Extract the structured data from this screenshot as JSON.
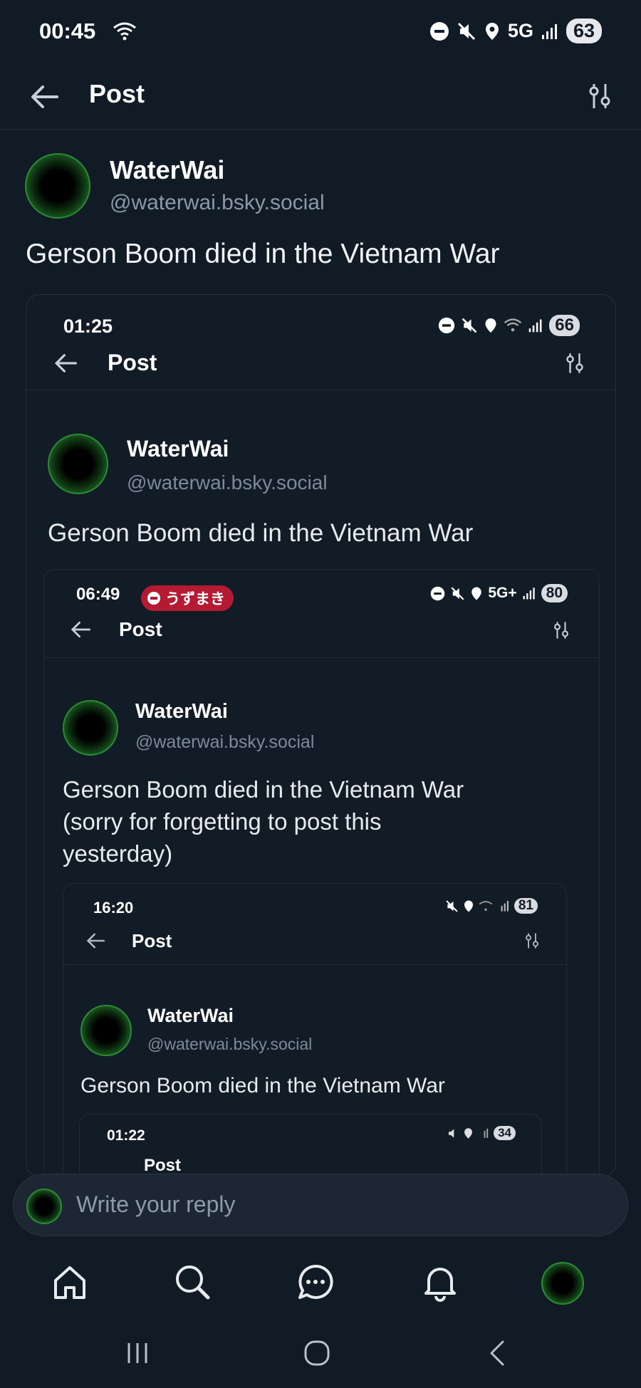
{
  "status_bar": {
    "time": "00:45",
    "network": "5G",
    "battery": "63"
  },
  "header": {
    "title": "Post"
  },
  "post": {
    "author_name": "WaterWai",
    "author_handle": "@waterwai.bsky.social",
    "text": "Gerson Boom died in the Vietnam War"
  },
  "embed_1": {
    "time": "01:25",
    "battery": "66",
    "title": "Post",
    "author_name": "WaterWai",
    "author_handle": "@waterwai.bsky.social",
    "text": "Gerson Boom died in the Vietnam War"
  },
  "embed_2": {
    "time": "06:49",
    "pill_label": "うずまき",
    "network": "5G+",
    "battery": "80",
    "title": "Post",
    "author_name": "WaterWai",
    "author_handle": "@waterwai.bsky.social",
    "text_line1": "Gerson Boom died in the Vietnam War",
    "text_line2": "(sorry for forgetting to post this",
    "text_line3": "yesterday)"
  },
  "embed_3": {
    "time": "16:20",
    "battery": "81",
    "title": "Post",
    "author_name": "WaterWai",
    "author_handle": "@waterwai.bsky.social",
    "text": "Gerson Boom died in the Vietnam War"
  },
  "embed_4": {
    "time": "01:22",
    "battery": "34",
    "title": "Post"
  },
  "reply": {
    "placeholder": "Write your reply"
  },
  "bottom_nav": [
    "home-icon",
    "search-icon",
    "chat-icon",
    "bell-icon",
    "profile-avatar"
  ],
  "colors": {
    "background": "#111b26",
    "accent_pill": "#b51a33",
    "avatar_green": "#2a8a35"
  }
}
